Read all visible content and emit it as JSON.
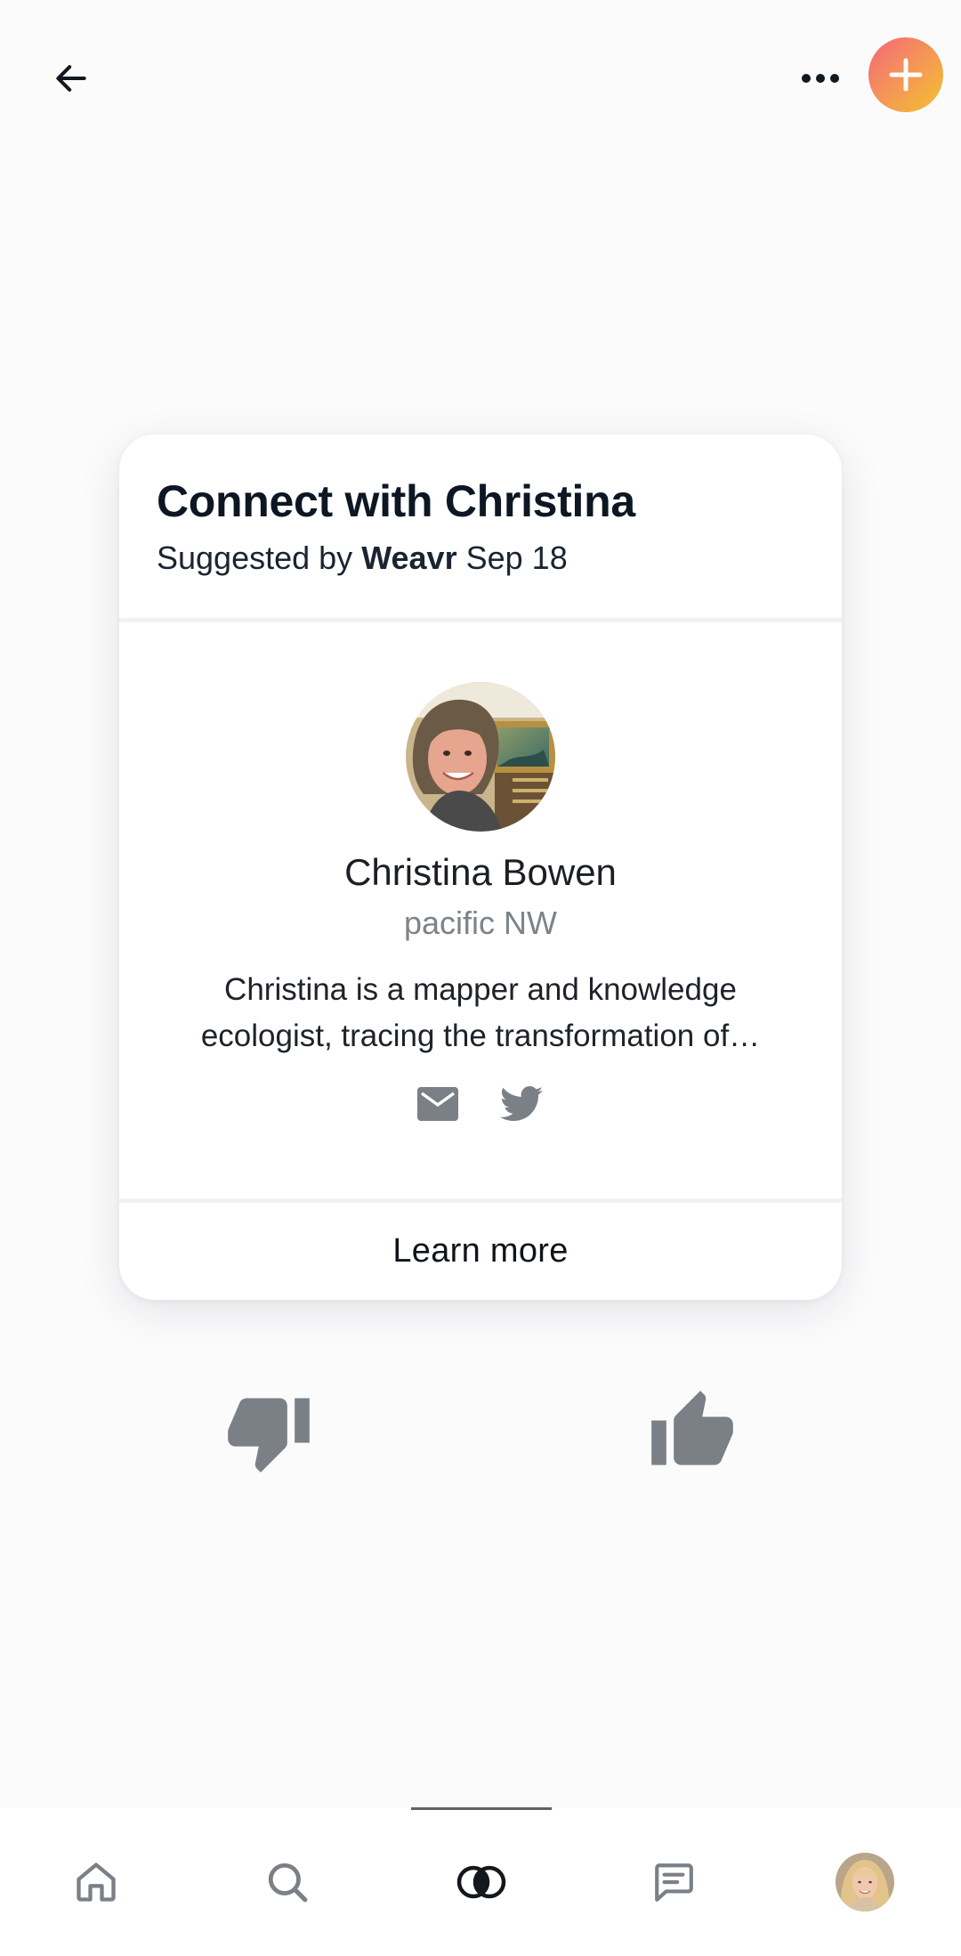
{
  "colors": {
    "accent_gradient": [
      "#f4677b",
      "#f59a52",
      "#f3c22f"
    ],
    "icon_gray": "#7b8086",
    "text_dark": "#0d1724",
    "text_muted": "#7c8389"
  },
  "top_bar": {
    "back_icon": "arrow-left-icon",
    "more_icon": "more-horizontal-icon",
    "add_icon": "plus-icon"
  },
  "card": {
    "title": "Connect with Christina",
    "suggested_prefix": "Suggested by",
    "suggested_by": "Weavr",
    "date": "Sep 18",
    "person": {
      "name": "Christina Bowen",
      "location": "pacific NW",
      "bio": "Christina is a mapper and knowledge ecologist, tracing the transformation of…"
    },
    "contact_icons": [
      "mail-icon",
      "twitter-icon"
    ],
    "learn_more": "Learn more"
  },
  "votes": {
    "down_icon": "thumbs-down-icon",
    "up_icon": "thumbs-up-icon"
  },
  "bottom_nav": {
    "items": [
      {
        "icon": "home-icon",
        "active": false
      },
      {
        "icon": "search-icon",
        "active": false
      },
      {
        "icon": "connect-icon",
        "active": true
      },
      {
        "icon": "messages-icon",
        "active": false
      },
      {
        "icon": "profile-avatar",
        "active": false
      }
    ]
  }
}
